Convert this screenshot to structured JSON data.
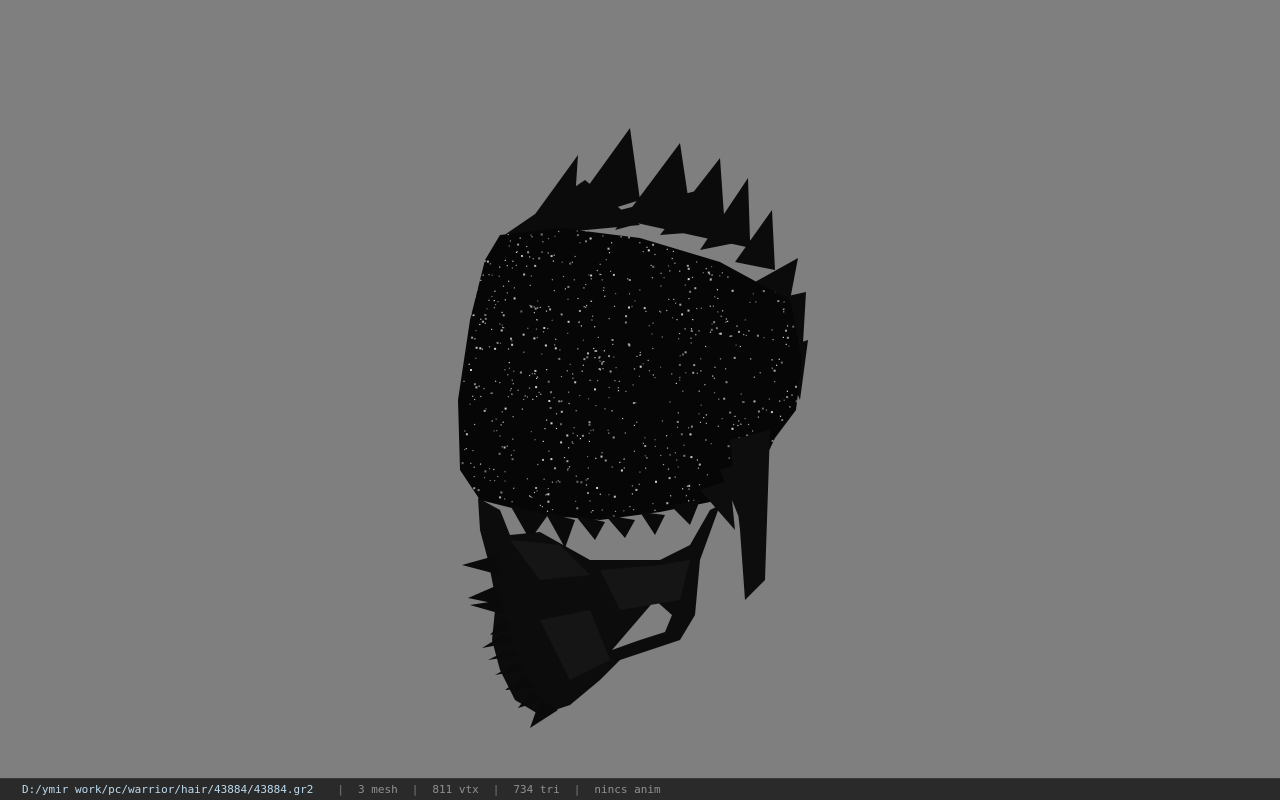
{
  "viewport": {
    "background_color": "#7f7f7f",
    "model_color": "#090909",
    "speckle_color": "#d8d8d8",
    "model_description_icon": "hair-mesh-icon"
  },
  "status": {
    "file_path": "D:/ymir work/pc/warrior/hair/43884/43884.gr2",
    "separator": "|",
    "mesh_count": "3 mesh",
    "vertex_count": "811 vtx",
    "triangle_count": "734 tri",
    "anim_status": "nincs anim"
  }
}
